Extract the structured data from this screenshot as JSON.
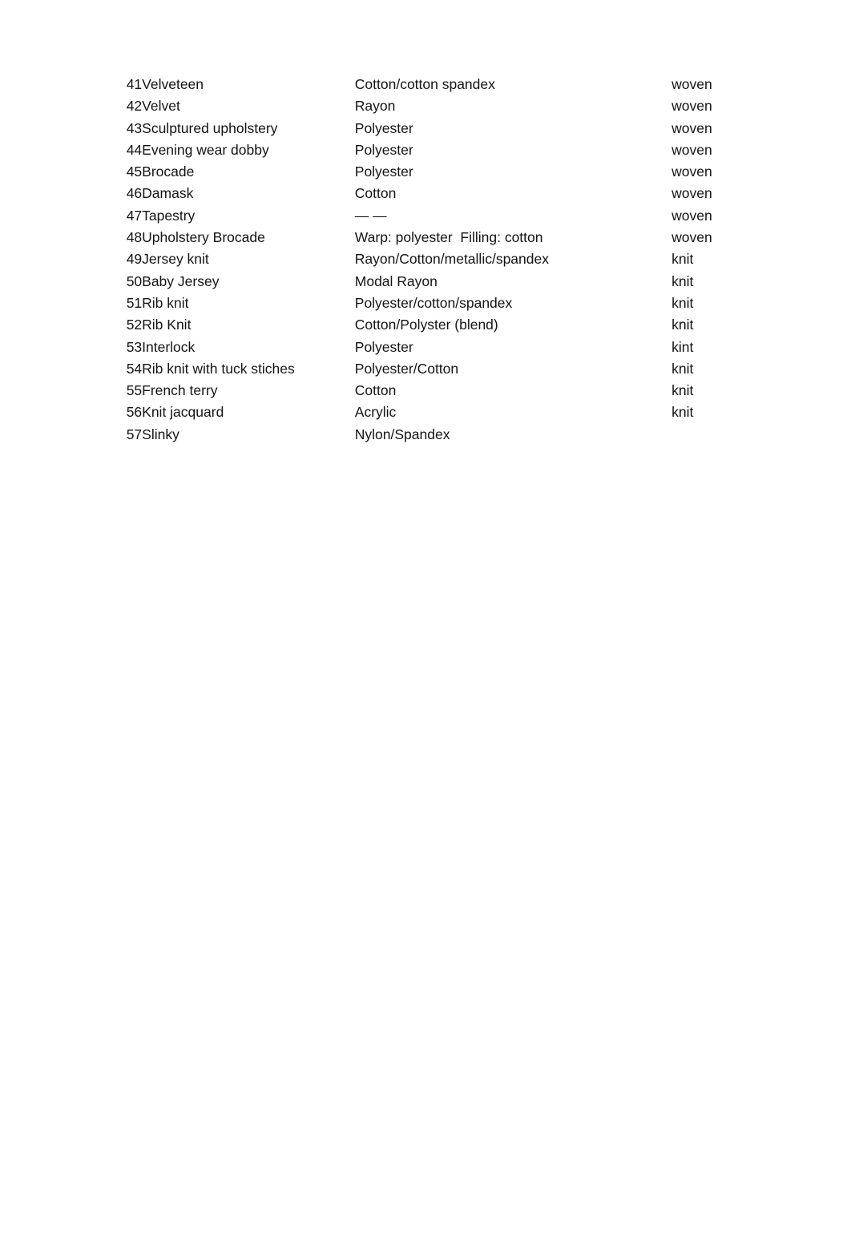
{
  "document": {
    "type": "fabric-reference-list",
    "background_color": "#ffffff",
    "text_color": "#141414"
  },
  "table": {
    "columns": [
      {
        "key": "index",
        "label": ""
      },
      {
        "key": "name",
        "label": ""
      },
      {
        "key": "fiber",
        "label": ""
      },
      {
        "key": "construction",
        "label": ""
      }
    ],
    "rows": [
      {
        "index": "41",
        "name": "Velveteen",
        "fiber": "Cotton/cotton spandex",
        "construction": "woven"
      },
      {
        "index": "42",
        "name": "Velvet",
        "fiber": "Rayon",
        "construction": "woven"
      },
      {
        "index": "43",
        "name": "Sculptured upholstery",
        "fiber": "Polyester",
        "construction": "woven"
      },
      {
        "index": "44",
        "name": "Evening wear dobby",
        "fiber": "Polyester",
        "construction": "woven"
      },
      {
        "index": "45",
        "name": "Brocade",
        "fiber": "Polyester",
        "construction": "woven"
      },
      {
        "index": "46",
        "name": "Damask",
        "fiber": "Cotton",
        "construction": "woven"
      },
      {
        "index": "47",
        "name": "Tapestry",
        "fiber": "— —",
        "construction": "woven"
      },
      {
        "index": "48",
        "name": "Upholstery Brocade",
        "fiber": "Warp: polyester  Filling: cotton",
        "construction": "woven"
      },
      {
        "index": "49",
        "name": "Jersey knit",
        "fiber": "Rayon/Cotton/metallic/spandex",
        "construction": "knit"
      },
      {
        "index": "50",
        "name": "Baby Jersey",
        "fiber": "Modal Rayon",
        "construction": "knit"
      },
      {
        "index": "51",
        "name": "Rib knit",
        "fiber": "Polyester/cotton/spandex",
        "construction": "knit"
      },
      {
        "index": "52",
        "name": "Rib Knit",
        "fiber": "Cotton/Polyster (blend)",
        "construction": "knit"
      },
      {
        "index": "53",
        "name": "Interlock",
        "fiber": "Polyester",
        "construction": "kint"
      },
      {
        "index": "54",
        "name": "Rib knit with tuck stiches",
        "fiber": "Polyester/Cotton",
        "construction": "knit"
      },
      {
        "index": "55",
        "name": "French terry",
        "fiber": "Cotton",
        "construction": "knit"
      },
      {
        "index": "56",
        "name": "Knit jacquard",
        "fiber": "Acrylic",
        "construction": "knit"
      },
      {
        "index": "57",
        "name": "Slinky",
        "fiber": "Nylon/Spandex",
        "construction": ""
      }
    ]
  }
}
